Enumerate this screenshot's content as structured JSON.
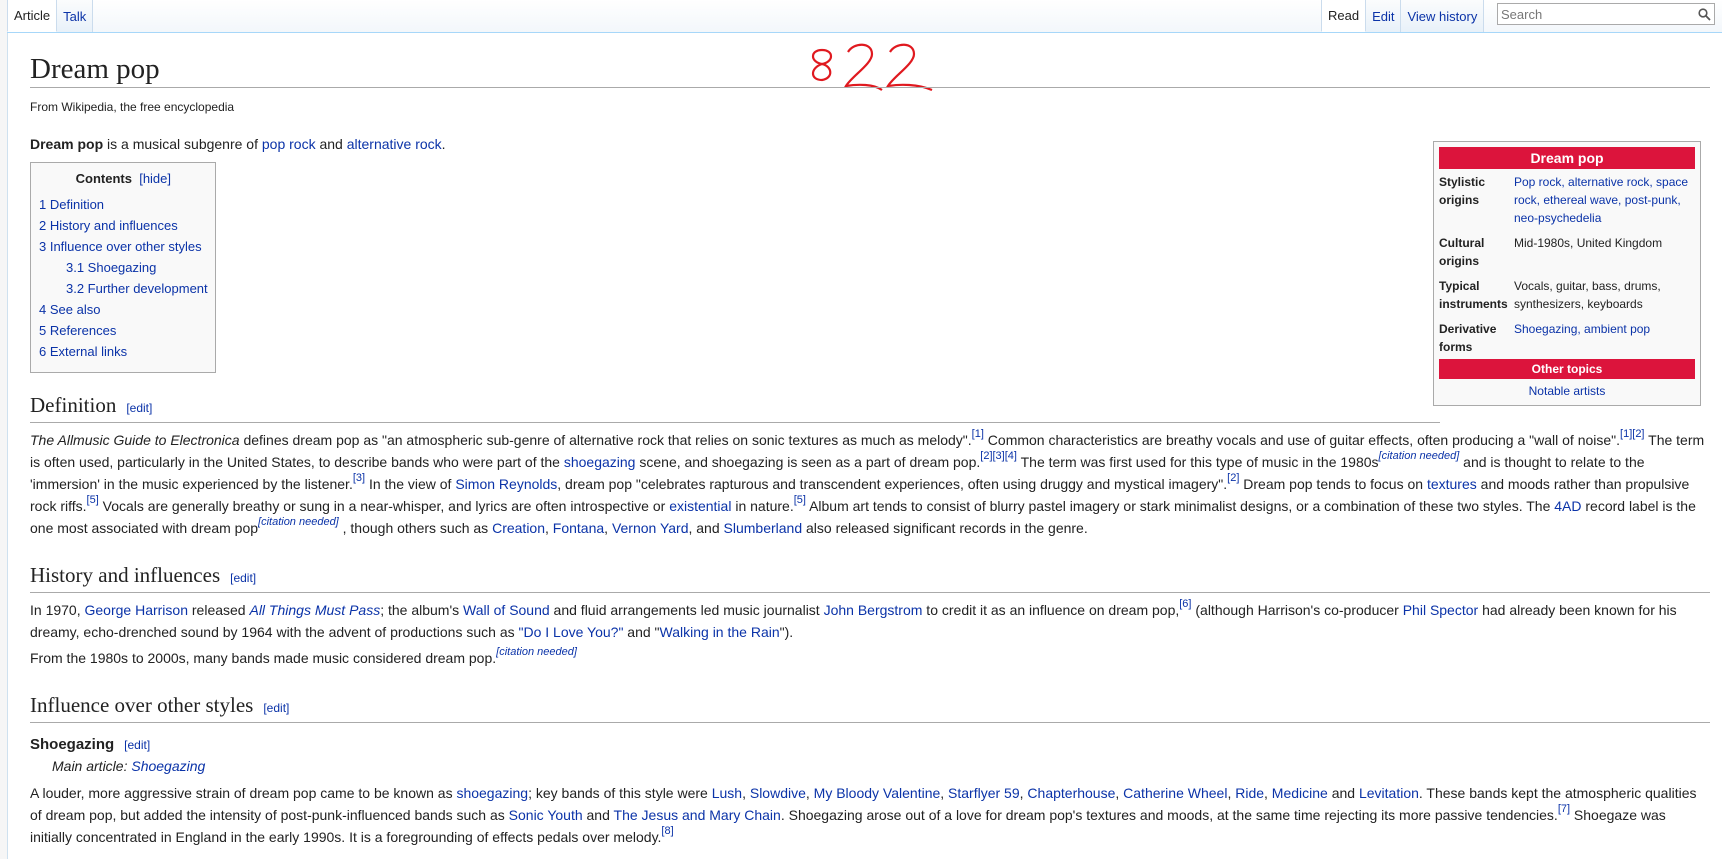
{
  "tabs": {
    "article": "Article",
    "talk": "Talk",
    "read": "Read",
    "edit": "Edit",
    "history": "View history"
  },
  "search": {
    "placeholder": "Search",
    "icon": "magnifier-icon"
  },
  "annotation": {
    "text": "822",
    "color": "#e0191f"
  },
  "page": {
    "title": "Dream pop",
    "subtitle": "From Wikipedia, the free encyclopedia"
  },
  "lead": {
    "term": "Dream pop",
    "t1": " is a musical subgenre of ",
    "l1": "pop rock",
    "t2": " and ",
    "l2": "alternative rock",
    "t3": "."
  },
  "toc": {
    "title": "Contents",
    "hide": "[hide]",
    "items": [
      "1 Definition",
      "2 History and influences",
      "3 Influence over other styles",
      "3.1 Shoegazing",
      "3.2 Further development",
      "4 See also",
      "5 References",
      "6 External links"
    ]
  },
  "infobox": {
    "title": "Dream pop",
    "accent_color": "#dc143c",
    "rows": [
      {
        "label": "Stylistic origins",
        "value": "Pop rock, alternative rock, space rock, ethereal wave, post-punk, neo-psychedelia"
      },
      {
        "label": "Cultural origins",
        "value": "Mid-1980s, United Kingdom"
      },
      {
        "label": "Typical instruments",
        "value": "Vocals, guitar, bass, drums, synthesizers, keyboards"
      },
      {
        "label": "Derivative forms",
        "value": "Shoegazing, ambient pop"
      }
    ],
    "other_topics": "Other topics",
    "notable": "Notable artists"
  },
  "edit_label": "[edit]",
  "definition": {
    "heading": "Definition",
    "p": {
      "a1": "The Allmusic Guide to Electronica",
      "a2": " defines dream pop as \"an atmospheric sub-genre of alternative rock that relies on sonic textures as much as melody\".",
      "r1": "[1]",
      "a3": " Common characteristics are breathy vocals and use of guitar effects, often producing a \"wall of noise\".",
      "r12": "[1][2]",
      "a4": " The term is often used, particularly in the United States, to describe bands who were part of the ",
      "l_shoe": "shoegazing",
      "a5": " scene, and shoegazing is seen as a part of dream pop.",
      "r234": "[2][3][4]",
      "a6": " The term was first used for this type of music in the 1980s",
      "cn1": "[citation needed]",
      "a7": " and is thought to relate to the 'immersion' in the music experienced by the listener.",
      "r3": "[3]",
      "a8": " In the view of ",
      "l_simon": "Simon Reynolds",
      "a9": ", dream pop \"celebrates rapturous and transcendent experiences, often using druggy and mystical imagery\".",
      "r2": "[2]",
      "a10": " Dream pop tends to focus on ",
      "l_text": "textures",
      "a11": " and moods rather than propulsive rock riffs.",
      "r5a": "[5]",
      "a12": " Vocals are generally breathy or sung in a near-whisper, and lyrics are often introspective or ",
      "l_exist": "existential",
      "a13": " in nature.",
      "r5b": "[5]",
      "a14": " Album art tends to consist of blurry pastel imagery or stark minimalist designs, or a combination of these two styles. The ",
      "l_4ad": "4AD",
      "a15": " record label is the one most associated with dream pop",
      "cn2": "[citation needed]",
      "a16": " , though others such as ",
      "l_creation": "Creation",
      "a17": ", ",
      "l_fontana": "Fontana",
      "a18": ", ",
      "l_vernon": "Vernon Yard",
      "a19": ", and ",
      "l_slumber": "Slumberland",
      "a20": " also released significant records in the genre."
    }
  },
  "history": {
    "heading": "History and influences",
    "p1": {
      "b1": "In 1970, ",
      "l_george": "George Harrison",
      "b2": " released ",
      "l_atmp": "All Things Must Pass",
      "b3": "; the album's ",
      "l_wall": "Wall of Sound",
      "b4": " and fluid arrangements led music journalist ",
      "l_john": "John Bergstrom",
      "b5": " to credit it as an influence on dream pop,",
      "r6": "[6]",
      "b6": " (although Harrison's co-producer ",
      "l_phil": "Phil Spector",
      "b7": " had already been known for his dreamy, echo-drenched sound by 1964 with the advent of productions such as ",
      "l_doyou": "\"Do I Love You?\"",
      "b8": " and \"",
      "l_walking": "Walking in the Rain",
      "b9": "\")."
    },
    "p2": {
      "c1": "From the 1980s to 2000s, many bands made music considered dream pop.",
      "cn": "[citation needed]"
    }
  },
  "influence": {
    "heading": "Influence over other styles",
    "sub_heading": "Shoegazing",
    "hatnote_prefix": "Main article: ",
    "hatnote_link": "Shoegazing",
    "p": {
      "d1": "A louder, more aggressive strain of dream pop came to be known as ",
      "l_shoe": "shoegazing",
      "d2": "; key bands of this style were ",
      "l_lush": "Lush",
      "s1": ", ",
      "l_slowdive": "Slowdive",
      "s2": ", ",
      "l_mbv": "My Bloody Valentine",
      "s3": ", ",
      "l_starflyer": "Starflyer 59",
      "s4": ", ",
      "l_chapter": "Chapterhouse",
      "s5": ", ",
      "l_catherine": "Catherine Wheel",
      "s6": ", ",
      "l_ride": "Ride",
      "s7": ", ",
      "l_medicine": "Medicine",
      "d3": " and ",
      "l_levitation": "Levitation",
      "d4": ". These bands kept the atmospheric qualities of dream pop, but added the intensity of post-punk-influenced bands such as ",
      "l_sonic": "Sonic Youth",
      "d5": " and ",
      "l_jesus": "The Jesus and Mary Chain",
      "d6": ". Shoegazing arose out of a love for dream pop's textures and moods, at the same time rejecting its more passive tendencies.",
      "r7": "[7]",
      "d7": " Shoegaze was initially concentrated in England in the early 1990s. It is a foregrounding of effects pedals over melody.",
      "r8": "[8]"
    }
  }
}
